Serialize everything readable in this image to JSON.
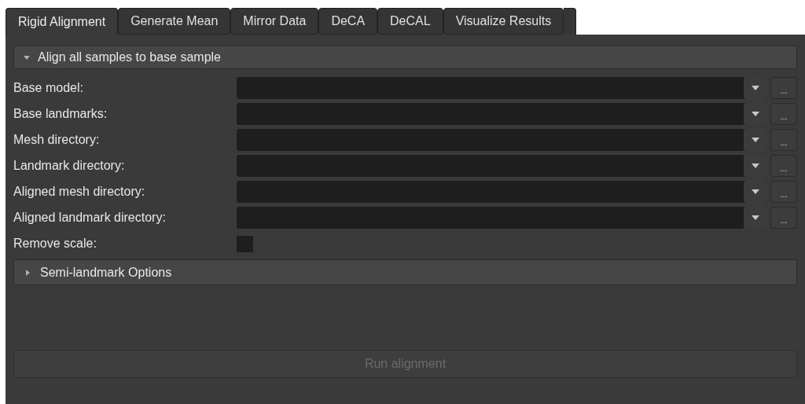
{
  "tabs": [
    {
      "label": "Rigid Alignment",
      "selected": true
    },
    {
      "label": "Generate Mean",
      "selected": false
    },
    {
      "label": "Mirror Data",
      "selected": false
    },
    {
      "label": "DeCA",
      "selected": false
    },
    {
      "label": "DeCAL",
      "selected": false
    },
    {
      "label": "Visualize Results",
      "selected": false
    }
  ],
  "section": {
    "title": "Align all samples to base sample",
    "expanded": true
  },
  "fields": [
    {
      "kind": "path",
      "label": "Base model:",
      "browse": "..."
    },
    {
      "kind": "path",
      "label": "Base landmarks:",
      "browse": "..."
    },
    {
      "kind": "path",
      "label": "Mesh directory:",
      "browse": "..."
    },
    {
      "kind": "path",
      "label": "Landmark directory:",
      "browse": "..."
    },
    {
      "kind": "path",
      "label": "Aligned mesh directory:",
      "browse": "..."
    },
    {
      "kind": "path",
      "label": "Aligned landmark directory:",
      "browse": "..."
    },
    {
      "kind": "checkbox",
      "label": "Remove scale:",
      "checked": false
    }
  ],
  "subsection": {
    "title": "Semi-landmark Options",
    "expanded": false
  },
  "run_button": {
    "label": "Run alignment",
    "disabled": true
  }
}
